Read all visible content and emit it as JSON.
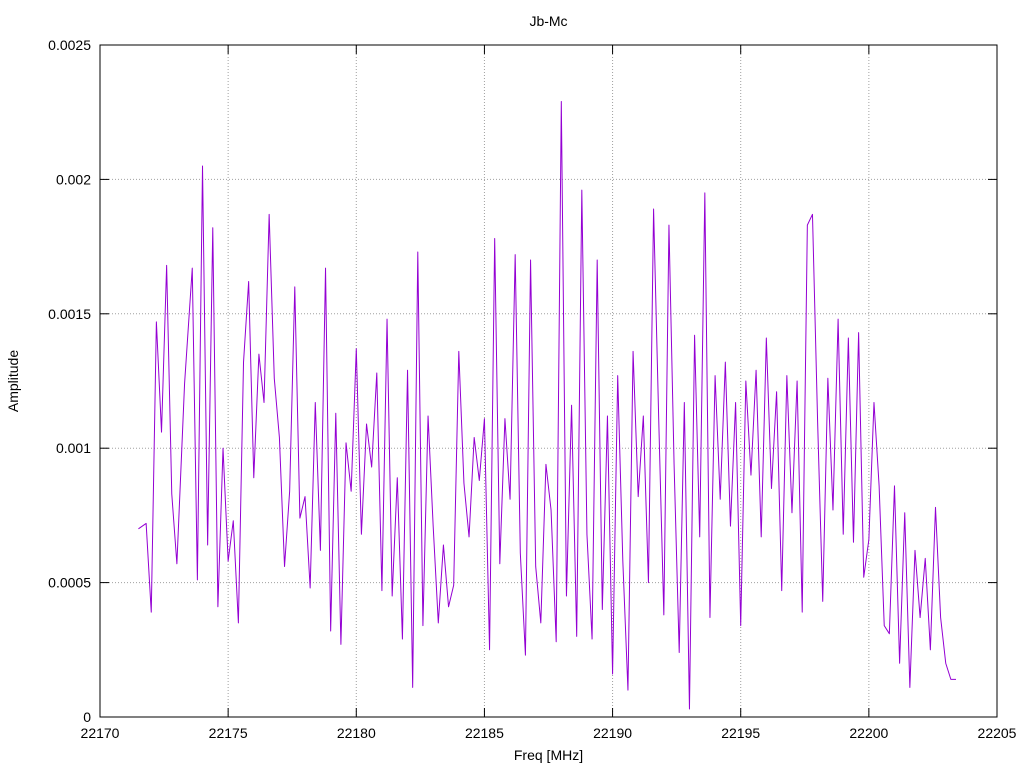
{
  "chart_data": {
    "type": "line",
    "title": "Jb-Mc",
    "xlabel": "Freq [MHz]",
    "ylabel": "Amplitude",
    "xlim": [
      22170,
      22205
    ],
    "ylim": [
      0,
      0.0025
    ],
    "xticks": [
      22170,
      22175,
      22180,
      22185,
      22190,
      22195,
      22200,
      22205
    ],
    "xtick_labels": [
      "22170",
      "22175",
      "22180",
      "22185",
      "22190",
      "22195",
      "22200",
      "22205"
    ],
    "yticks": [
      0,
      0.0005,
      0.001,
      0.0015,
      0.002,
      0.0025
    ],
    "ytick_labels": [
      "0",
      "0.0005",
      "0.001",
      "0.0015",
      "0.002",
      "0.0025"
    ],
    "grid": true,
    "line_color": "#9400d3",
    "series": [
      {
        "x": [
          22171.5,
          22171.8,
          22172.0,
          22172.2,
          22172.4,
          22172.6,
          22172.8,
          22173.0,
          22173.3,
          22173.6,
          22173.8,
          22174.0,
          22174.2,
          22174.4,
          22174.6,
          22174.8,
          22175.0,
          22175.2,
          22175.4,
          22175.6,
          22175.8,
          22176.0,
          22176.2,
          22176.4,
          22176.6,
          22176.8,
          22177.0,
          22177.2,
          22177.4,
          22177.6,
          22177.8,
          22178.0,
          22178.2,
          22178.4,
          22178.6,
          22178.8,
          22179.0,
          22179.2,
          22179.4,
          22179.6,
          22179.8,
          22180.0,
          22180.2,
          22180.4,
          22180.6,
          22180.8,
          22181.0,
          22181.2,
          22181.4,
          22181.6,
          22181.8,
          22182.0,
          22182.2,
          22182.4,
          22182.6,
          22182.8,
          22183.0,
          22183.2,
          22183.4,
          22183.6,
          22183.8,
          22184.0,
          22184.2,
          22184.4,
          22184.6,
          22184.8,
          22185.0,
          22185.2,
          22185.4,
          22185.6,
          22185.8,
          22186.0,
          22186.2,
          22186.4,
          22186.6,
          22186.8,
          22187.0,
          22187.2,
          22187.4,
          22187.6,
          22187.8,
          22188.0,
          22188.2,
          22188.4,
          22188.6,
          22188.8,
          22189.0,
          22189.2,
          22189.4,
          22189.6,
          22189.8,
          22190.0,
          22190.2,
          22190.4,
          22190.6,
          22190.8,
          22191.0,
          22191.2,
          22191.4,
          22191.6,
          22191.8,
          22192.0,
          22192.2,
          22192.4,
          22192.6,
          22192.8,
          22193.0,
          22193.2,
          22193.4,
          22193.6,
          22193.8,
          22194.0,
          22194.2,
          22194.4,
          22194.6,
          22194.8,
          22195.0,
          22195.2,
          22195.4,
          22195.6,
          22195.8,
          22196.0,
          22196.2,
          22196.4,
          22196.6,
          22196.8,
          22197.0,
          22197.2,
          22197.4,
          22197.6,
          22197.8,
          22198.0,
          22198.2,
          22198.4,
          22198.6,
          22198.8,
          22199.0,
          22199.2,
          22199.4,
          22199.6,
          22199.8,
          22200.0,
          22200.2,
          22200.4,
          22200.6,
          22200.8,
          22201.0,
          22201.2,
          22201.4,
          22201.6,
          22201.8,
          22202.0,
          22202.2,
          22202.4,
          22202.6,
          22202.8,
          22203.0,
          22203.2,
          22203.4
        ],
        "y": [
          0.0007,
          0.00072,
          0.00039,
          0.00147,
          0.00106,
          0.00168,
          0.00083,
          0.00057,
          0.00124,
          0.00167,
          0.00051,
          0.00205,
          0.00064,
          0.00182,
          0.00041,
          0.001,
          0.00058,
          0.00073,
          0.00035,
          0.00132,
          0.00162,
          0.00089,
          0.00135,
          0.00117,
          0.00187,
          0.00126,
          0.00104,
          0.00056,
          0.00084,
          0.0016,
          0.00074,
          0.00082,
          0.00048,
          0.00117,
          0.00062,
          0.00167,
          0.00032,
          0.00113,
          0.00027,
          0.00102,
          0.00084,
          0.00137,
          0.00068,
          0.00109,
          0.00093,
          0.00128,
          0.00047,
          0.00148,
          0.00045,
          0.00089,
          0.00029,
          0.00129,
          0.00011,
          0.00173,
          0.00034,
          0.00112,
          0.00071,
          0.00035,
          0.00064,
          0.00041,
          0.00049,
          0.00136,
          0.00087,
          0.00067,
          0.00104,
          0.00088,
          0.00111,
          0.00025,
          0.00178,
          0.00057,
          0.00111,
          0.00081,
          0.00172,
          0.00061,
          0.00023,
          0.0017,
          0.00056,
          0.00035,
          0.00094,
          0.00077,
          0.00028,
          0.00229,
          0.00045,
          0.00116,
          0.0003,
          0.00196,
          0.00068,
          0.00029,
          0.0017,
          0.0004,
          0.00112,
          0.00016,
          0.00127,
          0.00058,
          0.0001,
          0.00136,
          0.00082,
          0.00112,
          0.0005,
          0.00189,
          0.00111,
          0.00038,
          0.00183,
          0.00094,
          0.00024,
          0.00117,
          3e-05,
          0.00142,
          0.00067,
          0.00195,
          0.00037,
          0.00127,
          0.00081,
          0.00132,
          0.00071,
          0.00117,
          0.00034,
          0.00125,
          0.0009,
          0.00129,
          0.00067,
          0.00141,
          0.00085,
          0.00121,
          0.00047,
          0.00127,
          0.00076,
          0.00125,
          0.00039,
          0.00183,
          0.00187,
          0.0011,
          0.00043,
          0.00126,
          0.00077,
          0.00148,
          0.00068,
          0.00141,
          0.00065,
          0.00143,
          0.00052,
          0.00066,
          0.00117,
          0.00086,
          0.00034,
          0.00031,
          0.00086,
          0.0002,
          0.00076,
          0.00011,
          0.00062,
          0.00037,
          0.00059,
          0.00025,
          0.00078,
          0.00037,
          0.0002,
          0.00014,
          0.00014
        ]
      }
    ]
  }
}
